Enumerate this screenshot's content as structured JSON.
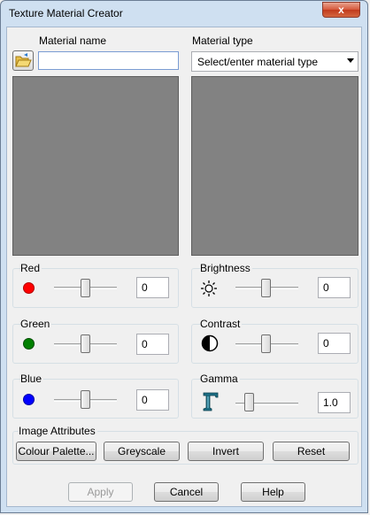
{
  "window": {
    "title": "Texture Material Creator",
    "close_glyph": "x"
  },
  "material_name": {
    "label": "Material name",
    "value": ""
  },
  "material_type": {
    "label": "Material type",
    "selected": "Select/enter material type"
  },
  "colour": {
    "red": {
      "label": "Red",
      "value": "0",
      "color": "#ff0000"
    },
    "green": {
      "label": "Green",
      "value": "0",
      "color": "#008000"
    },
    "blue": {
      "label": "Blue",
      "value": "0",
      "color": "#0000ff"
    }
  },
  "adjust": {
    "brightness": {
      "label": "Brightness",
      "value": "0"
    },
    "contrast": {
      "label": "Contrast",
      "value": "0"
    },
    "gamma": {
      "label": "Gamma",
      "value": "1.0"
    }
  },
  "image_attributes": {
    "label": "Image Attributes",
    "buttons": [
      "Colour Palette...",
      "Greyscale",
      "Invert",
      "Reset"
    ]
  },
  "footer": {
    "apply": "Apply",
    "cancel": "Cancel",
    "help": "Help"
  }
}
